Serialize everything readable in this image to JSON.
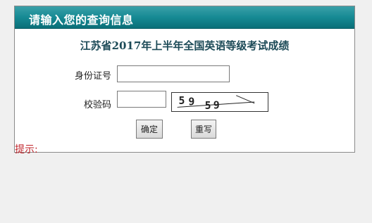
{
  "header": {
    "title": "请输入您的查询信息"
  },
  "exam_title": "江苏省2017年上半年全国英语等级考试成绩",
  "form": {
    "id_label": "身份证号",
    "id_value": "",
    "code_label": "校验码",
    "code_value": "",
    "captcha_text": "5959"
  },
  "buttons": {
    "ok": "确定",
    "reset": "重写"
  },
  "hint_text": "提示:",
  "colors": {
    "header": "#168a94",
    "hint": "#c0232a",
    "title": "#1c4a57"
  }
}
